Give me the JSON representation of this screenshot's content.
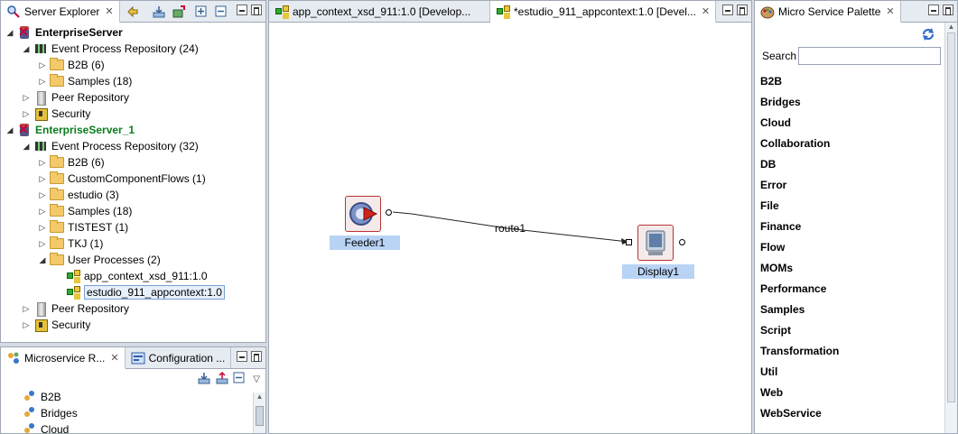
{
  "server_explorer": {
    "tab_label": "Server Explorer",
    "tree": [
      {
        "label": "EnterpriseServer",
        "level": 0,
        "kind": "server",
        "expanded": true,
        "style": "bold"
      },
      {
        "label": "Event Process Repository (24)",
        "level": 1,
        "kind": "repo",
        "expanded": true
      },
      {
        "label": "B2B (6)",
        "level": 2,
        "kind": "folder",
        "expanded": false
      },
      {
        "label": "Samples (18)",
        "level": 2,
        "kind": "folder",
        "expanded": false
      },
      {
        "label": "Peer Repository",
        "level": 1,
        "kind": "peer",
        "expanded": false
      },
      {
        "label": "Security",
        "level": 1,
        "kind": "security",
        "expanded": false
      },
      {
        "label": "EnterpriseServer_1",
        "level": 0,
        "kind": "server",
        "expanded": true,
        "style": "bold-green"
      },
      {
        "label": "Event Process Repository (32)",
        "level": 1,
        "kind": "repo",
        "expanded": true
      },
      {
        "label": "B2B (6)",
        "level": 2,
        "kind": "folder",
        "expanded": false
      },
      {
        "label": "CustomComponentFlows (1)",
        "level": 2,
        "kind": "folder",
        "expanded": false
      },
      {
        "label": "estudio (3)",
        "level": 2,
        "kind": "folder",
        "expanded": false
      },
      {
        "label": "Samples (18)",
        "level": 2,
        "kind": "folder",
        "expanded": false
      },
      {
        "label": "TISTEST (1)",
        "level": 2,
        "kind": "folder",
        "expanded": false
      },
      {
        "label": "TKJ (1)",
        "level": 2,
        "kind": "folder",
        "expanded": false
      },
      {
        "label": "User Processes (2)",
        "level": 2,
        "kind": "folder",
        "expanded": true
      },
      {
        "label": "app_context_xsd_911:1.0",
        "level": 3,
        "kind": "flow",
        "leaf": true
      },
      {
        "label": "estudio_911_appcontext:1.0",
        "level": 3,
        "kind": "flow",
        "leaf": true,
        "selected": true
      },
      {
        "label": "Peer Repository",
        "level": 1,
        "kind": "peer",
        "expanded": false
      },
      {
        "label": "Security",
        "level": 1,
        "kind": "security",
        "expanded": false
      }
    ]
  },
  "bottom_left": {
    "tabs": [
      {
        "label": "Microservice R...",
        "active": true
      },
      {
        "label": "Configuration ...",
        "active": false
      }
    ],
    "items": [
      "B2B",
      "Bridges",
      "Cloud"
    ]
  },
  "editor": {
    "tabs": [
      {
        "label": "app_context_xsd_911:1.0 [Develop...",
        "active": false
      },
      {
        "label": "*estudio_911_appcontext:1.0 [Devel...",
        "active": true
      }
    ],
    "nodes": {
      "feeder": {
        "label": "Feeder1"
      },
      "display": {
        "label": "Display1"
      }
    },
    "route_label": "route1"
  },
  "palette": {
    "tab_label": "Micro Service Palette",
    "search_label": "Search",
    "search_value": "",
    "categories": [
      "B2B",
      "Bridges",
      "Cloud",
      "Collaboration",
      "DB",
      "Error",
      "File",
      "Finance",
      "Flow",
      "MOMs",
      "Performance",
      "Samples",
      "Script",
      "Transformation",
      "Util",
      "Web",
      "WebService"
    ]
  }
}
